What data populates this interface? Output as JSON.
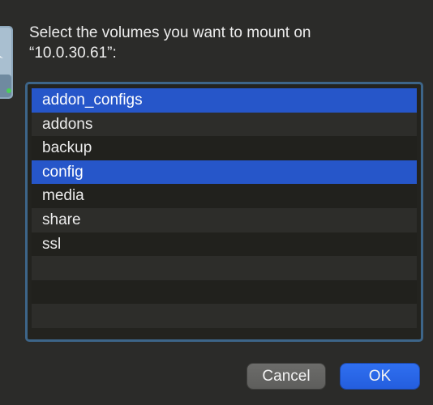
{
  "dialog": {
    "prompt_line1": "Select the volumes you want to mount on",
    "prompt_line2": "“10.0.30.61”:"
  },
  "volumes": [
    {
      "label": "addon_configs",
      "selected": true
    },
    {
      "label": "addons",
      "selected": false
    },
    {
      "label": "backup",
      "selected": false
    },
    {
      "label": "config",
      "selected": true
    },
    {
      "label": "media",
      "selected": false
    },
    {
      "label": "share",
      "selected": false
    },
    {
      "label": "ssl",
      "selected": false
    }
  ],
  "buttons": {
    "cancel_label": "Cancel",
    "ok_label": "OK"
  },
  "colors": {
    "selection": "#2656c9",
    "accent_button": "#2a66e8",
    "frame_focus": "#3d6589"
  },
  "icons": {
    "drive": "network-drive-icon"
  }
}
